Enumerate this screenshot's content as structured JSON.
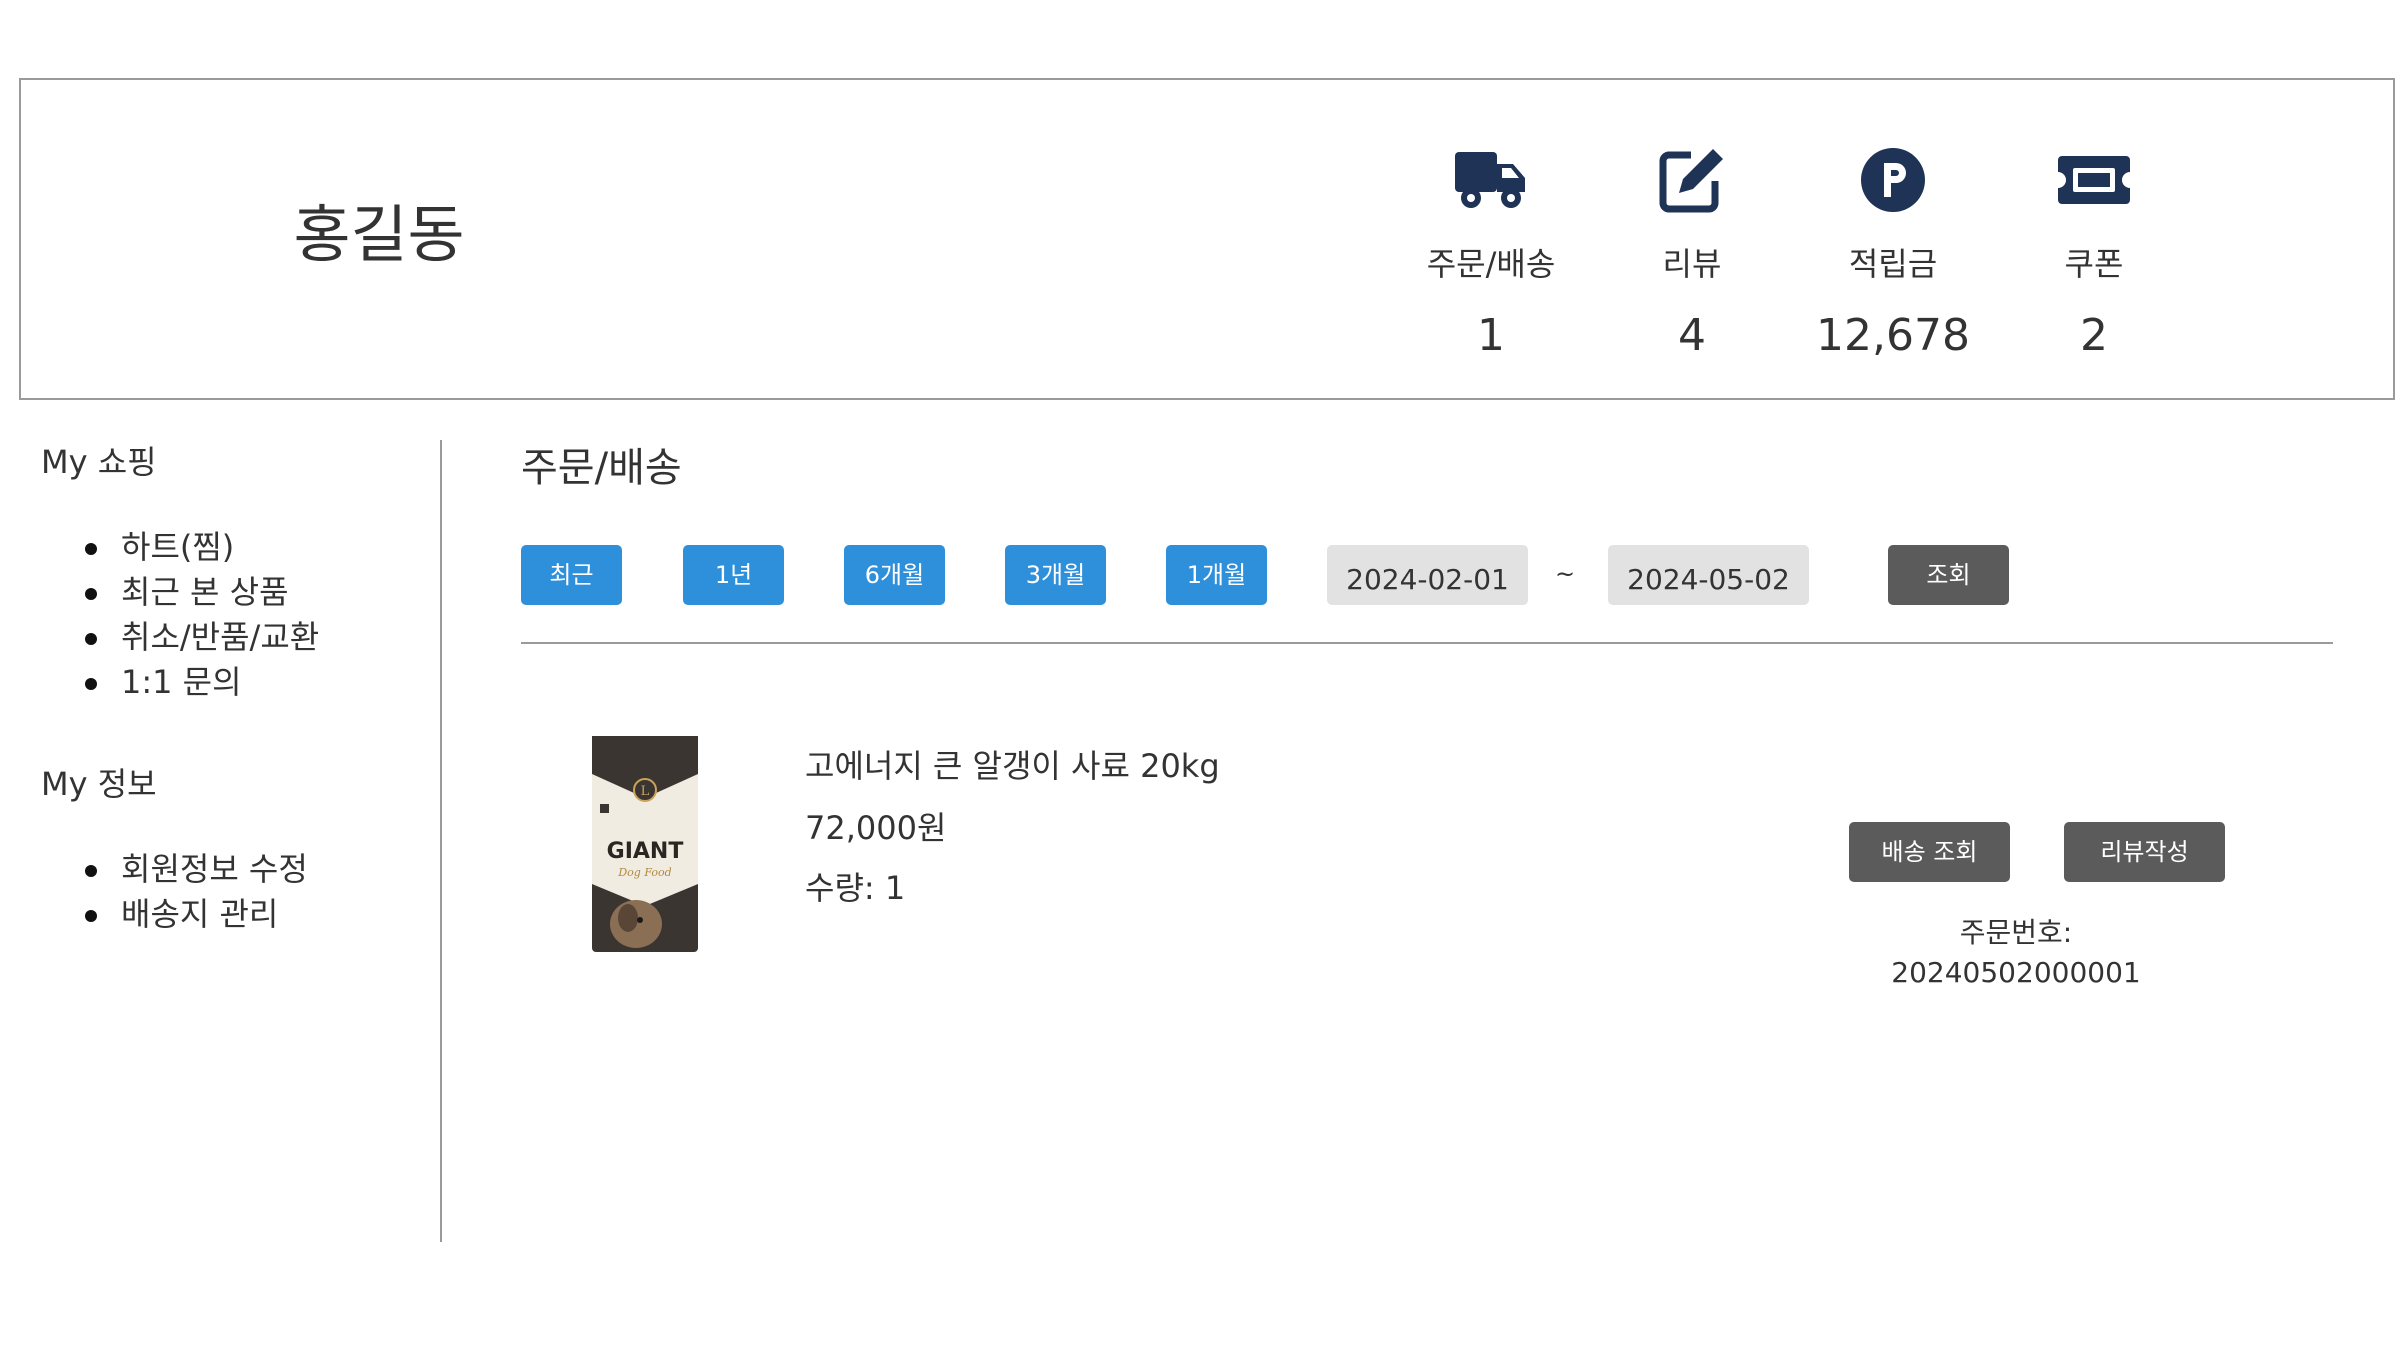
{
  "profile": {
    "user_name": "홍길동",
    "stats": [
      {
        "icon": "truck-icon",
        "label": "주문/배송",
        "value": "1"
      },
      {
        "icon": "edit-icon",
        "label": "리뷰",
        "value": "4"
      },
      {
        "icon": "points-icon",
        "label": "적립금",
        "value": "12,678"
      },
      {
        "icon": "ticket-icon",
        "label": "쿠폰",
        "value": "2"
      }
    ],
    "icon_color": "#1f3356"
  },
  "sidebar": {
    "shopping_title": "My 쇼핑",
    "shopping_items": [
      "하트(찜)",
      "최근 본 상품",
      "취소/반품/교환",
      "1:1 문의"
    ],
    "info_title": "My 정보",
    "info_items": [
      "회원정보 수정",
      "배송지 관리"
    ]
  },
  "main": {
    "title": "주문/배송",
    "period_buttons": [
      "최근",
      "1년",
      "6개월",
      "3개월",
      "1개월"
    ],
    "start_date": "2024-02-01",
    "tilde": "~",
    "end_date": "2024-05-02",
    "search_label": "조회",
    "accent_color": "#2e8fdb"
  },
  "order": {
    "product_name": "고에너지 큰 알갱이 사료 20kg",
    "price": "72,000원",
    "quantity": "수량: 1",
    "tracking_label": "배송 조회",
    "review_label": "리뷰작성",
    "order_number": "주문번호: 20240502000001",
    "image_text": "GIANT",
    "image_script": "Dog Food"
  }
}
